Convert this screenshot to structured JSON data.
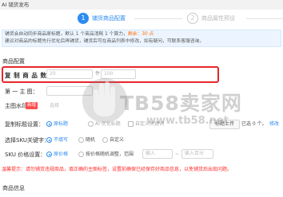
{
  "app": {
    "title": "AI 铺货发布"
  },
  "steps": [
    {
      "number": "1",
      "label": "铺货商品配置"
    },
    {
      "number": "2",
      "label": "商品属性预设"
    }
  ],
  "notice": {
    "line1_pre": "铺货会自动同步商品原标题，默认 1 个商品消耗 1 个算力，",
    "line1_highlight": "剩余：30 点",
    "line2": "建议对商品的标题先行优化后再铺货，铺货后可在商品列表中修改，如有疑问，可联系客服咨询。"
  },
  "product_config": {
    "section_title": "商品配置",
    "copy_count": {
      "label": "复 制 商 品 数：",
      "value": "20",
      "unit": "件",
      "value2": "100"
    },
    "first_main_image": {
      "label": "第 一 主 图：",
      "value": ""
    },
    "main_watermark": {
      "label": "主图水印",
      "tag": "新增",
      "option": "选择"
    },
    "title_mode": {
      "label": "复制标题设置：",
      "options": [
        "原标题",
        "AI 优化标题",
        "自定义关键词"
      ],
      "button": "标题上传",
      "count": "已选 0 个。",
      "edit": "修改"
    },
    "sku_keyword": {
      "label": "选择SKU关键字：",
      "options": [
        "不填写",
        "随机",
        "自定义"
      ]
    },
    "sku_price": {
      "label": "SKU 价格设置：",
      "options": [
        "原价格",
        "按价格随机调整，范围"
      ],
      "min_placeholder": "输入",
      "max_placeholder": "输入百分"
    },
    "warning": "温馨提示：请勿铺货违规商品，填正确的主图标签，设置前确保已经保存好商品信息，以免铺货后出现问题。"
  },
  "product_info": {
    "section_title": "商品信息"
  },
  "watermark": {
    "text": "TB58卖家网",
    "url": "www.tb58.net"
  },
  "colors": {
    "accent": "#2d8cf0",
    "highlight_border": "#e8262a",
    "warning": "#ff2a2a",
    "orange": "#ff6a00"
  }
}
